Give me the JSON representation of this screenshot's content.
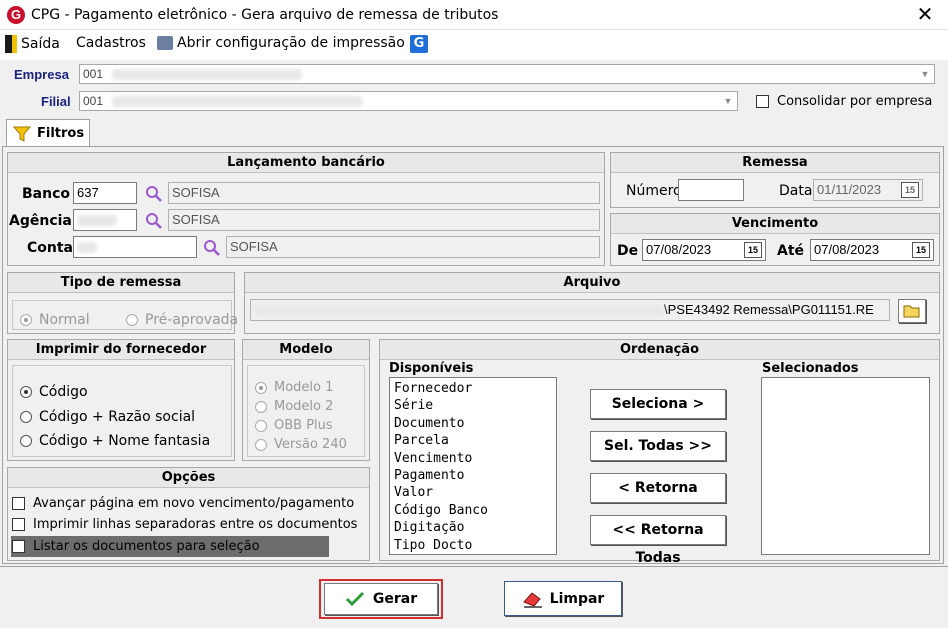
{
  "window": {
    "title": "CPG -  Pagamento eletrônico - Gera arquivo de remessa de tributos",
    "close": "✕",
    "logo": "G"
  },
  "toolbar": {
    "exit": "Saída",
    "cadastros": "Cadastros",
    "print_config": "Abrir configuração de impressão"
  },
  "empresa": {
    "label": "Empresa",
    "value": "001"
  },
  "filial": {
    "label": "Filial",
    "value": "001"
  },
  "consolidar": {
    "label": "Consolidar por empresa",
    "checked": false
  },
  "tab": {
    "label": "Filtros"
  },
  "lancamento": {
    "title": "Lançamento bancário",
    "banco_label": "Banco",
    "banco_value": "637",
    "banco_name": "SOFISA",
    "agencia_label": "Agência",
    "agencia_name": "SOFISA",
    "conta_label": "Conta",
    "conta_name": "SOFISA"
  },
  "remessa": {
    "title": "Remessa",
    "numero_label": "Número",
    "numero_value": "",
    "data_label": "Data",
    "data_value": "01/11/2023"
  },
  "vencimento": {
    "title": "Vencimento",
    "de_label": "De",
    "de_value": "07/08/2023",
    "ate_label": "Até",
    "ate_value": "07/08/2023"
  },
  "tipo_remessa": {
    "title": "Tipo de remessa",
    "options": [
      "Normal",
      "Pré-aprovada"
    ],
    "selected": "Normal"
  },
  "arquivo": {
    "title": "Arquivo",
    "path_visible": "\\PSE43492 Remessa\\PG011151.RE"
  },
  "imprimir_fornecedor": {
    "title": "Imprimir do fornecedor",
    "options": [
      "Código",
      "Código + Razão social",
      "Código + Nome fantasia"
    ],
    "selected": "Código"
  },
  "modelo": {
    "title": "Modelo",
    "options": [
      "Modelo 1",
      "Modelo 2",
      "OBB Plus",
      "Versão 240"
    ],
    "selected": "Modelo 1"
  },
  "opcoes": {
    "title": "Opções",
    "items": [
      {
        "label": "Avançar página em novo vencimento/pagamento",
        "checked": false
      },
      {
        "label": "Imprimir linhas separadoras entre os documentos",
        "checked": false
      },
      {
        "label": "Listar os documentos para seleção",
        "checked": false
      }
    ]
  },
  "ordenacao": {
    "title": "Ordenação",
    "disponiveis_label": "Disponíveis",
    "selecionados_label": "Selecionados",
    "disponiveis": [
      "Fornecedor",
      "Série",
      "Documento",
      "Parcela",
      "Vencimento",
      "Pagamento",
      "Valor",
      "Código Banco",
      "Digitação",
      "Tipo Docto"
    ],
    "selecionados": [],
    "btn_seleciona": "Seleciona >",
    "btn_sel_todas": "Sel. Todas >>",
    "btn_retorna": "< Retorna",
    "btn_retorna_todas": "<< Retorna Todas"
  },
  "footer": {
    "gerar": "Gerar",
    "limpar": "Limpar"
  },
  "colors": {
    "accent_red": "#c8102e",
    "label_blue": "#1a237e",
    "highlight_border": "#d32f2f"
  }
}
